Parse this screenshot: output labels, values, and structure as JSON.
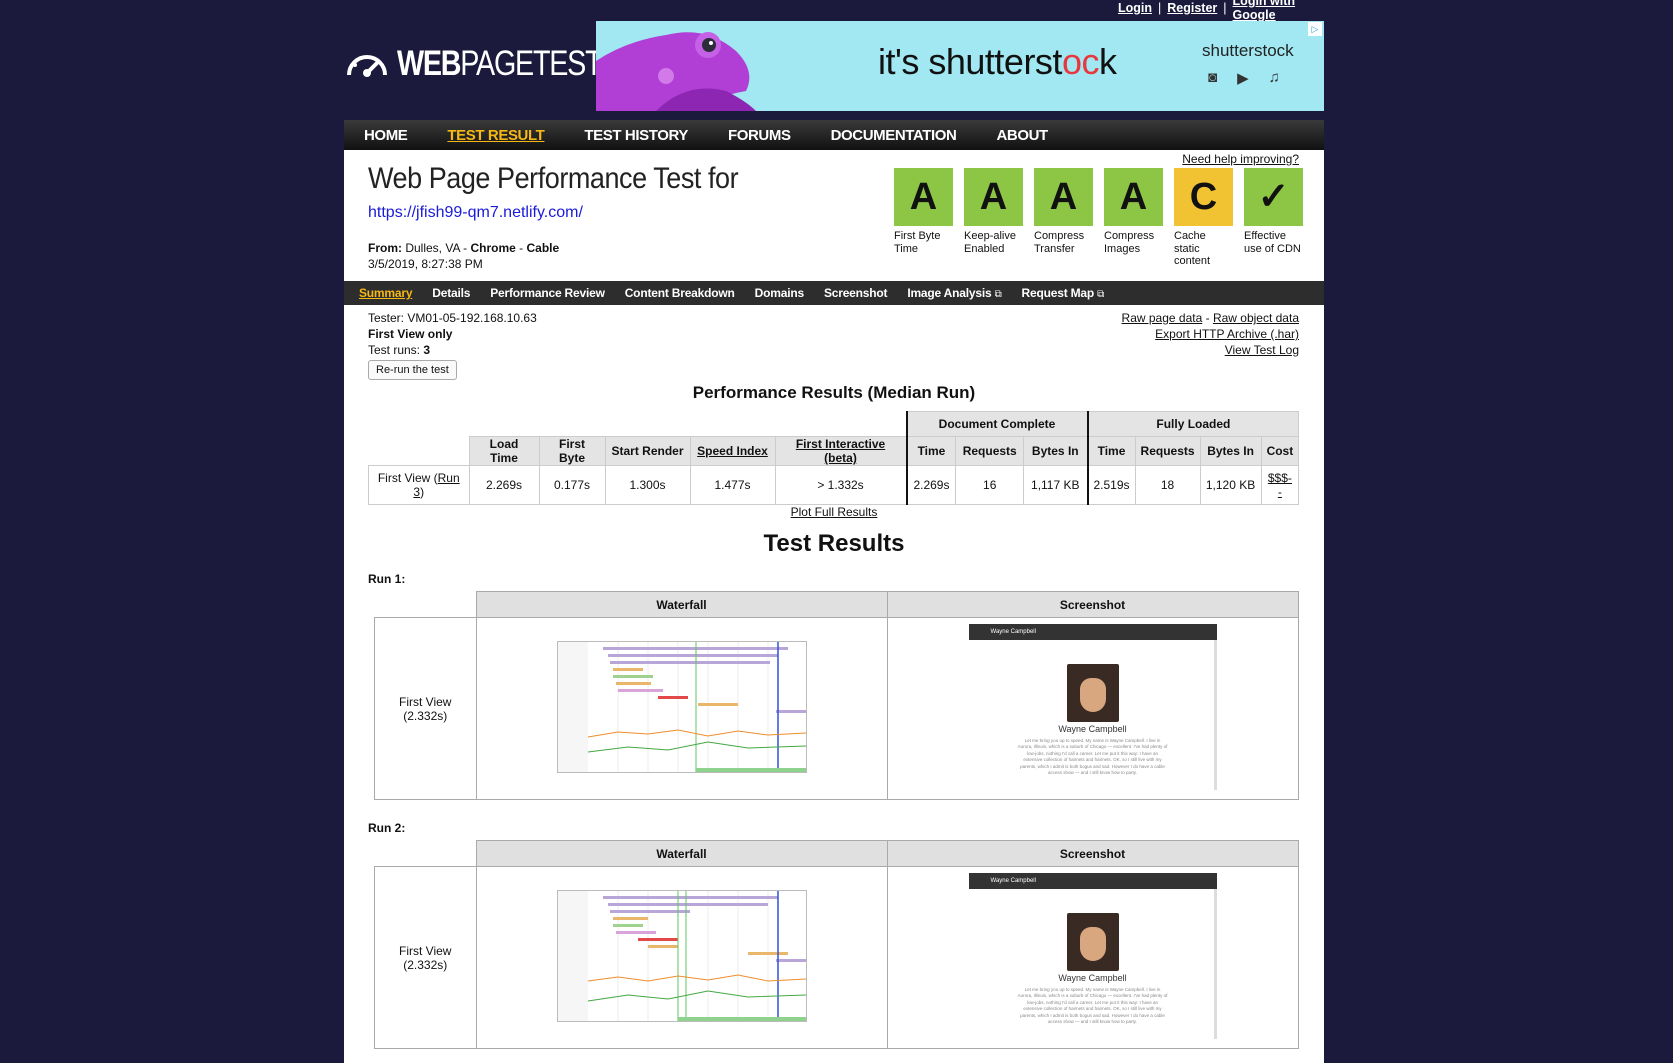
{
  "top_links": {
    "login": "Login",
    "sep1": "|",
    "register": "Register",
    "sep2": "|",
    "google": "Login with Google"
  },
  "logo": {
    "bold": "WEB",
    "rest": "PAGETEST"
  },
  "ad": {
    "slogan_pre": "it's shutterst",
    "slogan_c": "o",
    "slogan_c2": "c",
    "slogan_post": "k",
    "brand": "shutterstock",
    "adchoice": "▷"
  },
  "nav": {
    "home": "HOME",
    "test_result": "TEST RESULT",
    "test_history": "TEST HISTORY",
    "forums": "FORUMS",
    "documentation": "DOCUMENTATION",
    "about": "ABOUT"
  },
  "header": {
    "title": "Web Page Performance Test for",
    "url": "https://jfish99-qm7.netlify.com/",
    "from_label": "From:",
    "from_location": " Dulles, VA - ",
    "browser": "Chrome",
    "dash": " - ",
    "connection": "Cable",
    "datetime": "3/5/2019, 8:27:38 PM",
    "help": "Need help improving?"
  },
  "grades": [
    {
      "grade": "A",
      "label": "First Byte Time"
    },
    {
      "grade": "A",
      "label": "Keep-alive Enabled"
    },
    {
      "grade": "A",
      "label": "Compress Transfer"
    },
    {
      "grade": "A",
      "label": "Compress Images"
    },
    {
      "grade": "C",
      "label": "Cache static content"
    },
    {
      "grade": "✓",
      "label": "Effective use of CDN"
    }
  ],
  "subnav": {
    "summary": "Summary",
    "details": "Details",
    "perf_review": "Performance Review",
    "content_breakdown": "Content Breakdown",
    "domains": "Domains",
    "screenshot": "Screenshot",
    "image_analysis": "Image Analysis",
    "request_map": "Request Map",
    "ext_icon": "⧉"
  },
  "tester": {
    "tester": "Tester: VM01-05-192.168.10.63",
    "view": "First View only",
    "runs_label": "Test runs: ",
    "runs": "3",
    "rerun": "Re-run the test"
  },
  "raw": {
    "page_data": "Raw page data",
    "dash": " - ",
    "object_data": "Raw object data",
    "har": "Export HTTP Archive (.har)",
    "log": "View Test Log"
  },
  "perf": {
    "heading": "Performance Results (Median Run)",
    "group_doc": "Document Complete",
    "group_full": "Fully Loaded",
    "cols": {
      "load_time": "Load Time",
      "first_byte": "First Byte",
      "start_render": "Start Render",
      "speed_index": "Speed Index",
      "first_interactive": "First Interactive (beta)",
      "doc_time": "Time",
      "doc_requests": "Requests",
      "doc_bytes": "Bytes In",
      "full_time": "Time",
      "full_requests": "Requests",
      "full_bytes": "Bytes In",
      "cost": "Cost"
    },
    "row": {
      "label_pre": "First View (",
      "label_link": "Run 3",
      "label_post": ")",
      "load_time": "2.269s",
      "first_byte": "0.177s",
      "start_render": "1.300s",
      "speed_index": "1.477s",
      "first_interactive": "> 1.332s",
      "doc_time": "2.269s",
      "doc_requests": "16",
      "doc_bytes": "1,117 KB",
      "full_time": "2.519s",
      "full_requests": "18",
      "full_bytes": "1,120 KB",
      "cost": "$$$--"
    },
    "plot": "Plot Full Results"
  },
  "results": {
    "title": "Test Results",
    "waterfall": "Waterfall",
    "screenshot": "Screenshot",
    "runs": [
      {
        "label": "Run 1:",
        "view": "First View",
        "time": "(2.332s)",
        "site_name": "Wayne Campbell",
        "site_header": "Wayne Campbell",
        "site_text": "Let me bring you up to speed. My name is Wayne Campbell. I live in Aurora, Illinois, which is a suburb of Chicago — excellent. I've had plenty of low-jobs, nothing I'd call a career. Let me put it this way: I have an extensive collection of hairnets and hairnets. OK, so I still live with my parents, which I admit is both bogus and sad. However I do have a cable access show — and I still know how to party."
      },
      {
        "label": "Run 2:",
        "view": "First View",
        "time": "(2.332s)",
        "site_name": "Wayne Campbell",
        "site_header": "Wayne Campbell",
        "site_text": "Let me bring you up to speed. My name is Wayne Campbell. I live in Aurora, Illinois, which is a suburb of Chicago — excellent. I've had plenty of low-jobs, nothing I'd call a career. Let me put it this way: I have an extensive collection of hairnets and hairnets. OK, so I still live with my parents, which I admit is both bogus and sad. However I do have a cable access show — and I still know how to party."
      }
    ]
  }
}
